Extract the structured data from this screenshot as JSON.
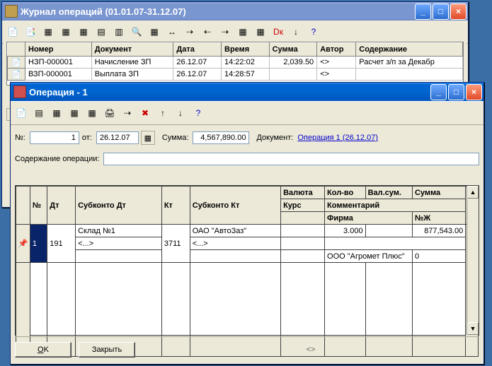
{
  "w1": {
    "title": "Журнал операций (01.01.07-31.12.07)",
    "cols": [
      "Номер",
      "Документ",
      "Дата",
      "Время",
      "Сумма",
      "Автор",
      "Содержание"
    ],
    "rows": [
      {
        "num": "НЗП-000001",
        "doc": "Начисление ЗП",
        "date": "26.12.07",
        "time": "14:22:02",
        "sum": "2,039.50",
        "auth": "<>",
        "cont": "Расчет з/п за Декабр"
      },
      {
        "num": "ВЗП-000001",
        "doc": "Выплата ЗП",
        "date": "26.12.07",
        "time": "14:28:57",
        "sum": "",
        "auth": "<>",
        "cont": ""
      }
    ]
  },
  "w2": {
    "title": "Операция - 1",
    "lbl_n": "№:",
    "val_n": "1",
    "lbl_ot": "от:",
    "val_date": "26.12.07",
    "lbl_sum": "Сумма:",
    "val_sum": "4,567,890.00",
    "lbl_doc": "Документ:",
    "link_doc": "Операция 1 (26.12.07)",
    "lbl_cont": "Содержание операции:",
    "val_cont": "",
    "h": {
      "n": "№",
      "dt": "Дт",
      "sdt": "Субконто Дт",
      "kt": "Кт",
      "skt": "Субконто Кт",
      "val": "Валюта",
      "kol": "Кол-во",
      "vs": "Вал.сум.",
      "sum": "Сумма",
      "kurs": "Курс",
      "kom": "Комментарий",
      "firma": "Фирма",
      "nz": "№Ж"
    },
    "row": {
      "n": "1",
      "dt": "191",
      "sdt1": "Склад №1",
      "sdt2": "<...>",
      "kt": "3711",
      "skt1": "ОАО \"АвтоЗаз\"",
      "skt2": "<...>",
      "kol": "3.000",
      "sum": "877,543.00",
      "firma": "ООО \"Агромет Плюс\"",
      "nz": "0"
    },
    "btn_ok": "OK",
    "btn_close": "Закрыть",
    "status": "<>"
  }
}
